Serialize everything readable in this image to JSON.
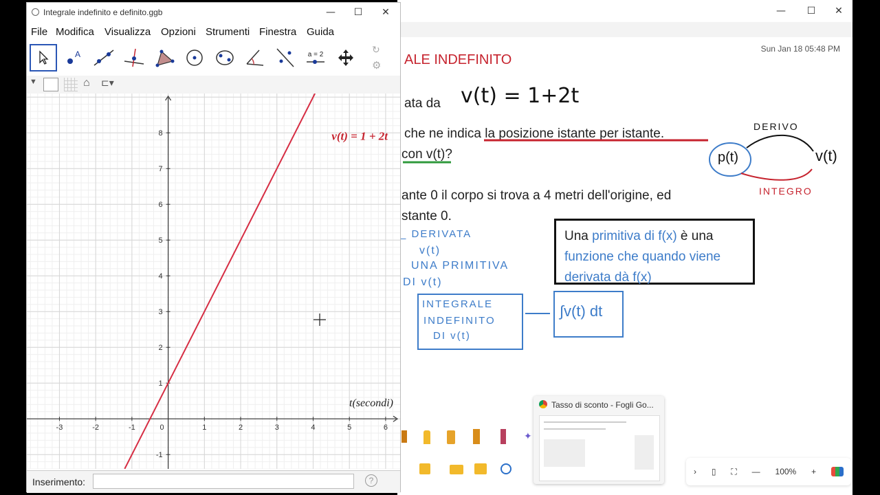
{
  "geogebra": {
    "title": "Integrale indefinito e definito.ggb",
    "menu": [
      "File",
      "Modifica",
      "Visualizza",
      "Opzioni",
      "Strumenti",
      "Finestra",
      "Guida"
    ],
    "tools": [
      {
        "icon": "move-tool-icon"
      },
      {
        "icon": "point-tool-icon"
      },
      {
        "icon": "line-tool-icon"
      },
      {
        "icon": "perpendicular-tool-icon"
      },
      {
        "icon": "polygon-tool-icon"
      },
      {
        "icon": "circle-tool-icon"
      },
      {
        "icon": "conic-tool-icon"
      },
      {
        "icon": "angle-tool-icon"
      },
      {
        "icon": "reflect-tool-icon"
      },
      {
        "icon": "slider-tool-icon",
        "label": "a = 2"
      },
      {
        "icon": "move-graphics-tool-icon"
      }
    ],
    "input_label": "Inserimento:",
    "input_value": "",
    "input_placeholder": ""
  },
  "chart_data": {
    "type": "line",
    "function_label": "v(t) = 1 + 2t",
    "xlabel": "t(secondi)",
    "ylabel": "",
    "xlim": [
      -3.9,
      6.4
    ],
    "ylim": [
      -1.4,
      9.1
    ],
    "x_ticks": [
      -3,
      -2,
      -1,
      0,
      1,
      2,
      3,
      4,
      5,
      6
    ],
    "y_ticks": [
      -1,
      1,
      2,
      3,
      4,
      5,
      6,
      7,
      8
    ],
    "grid": true,
    "series": [
      {
        "x": [
          -1.2,
          4.05
        ],
        "y": [
          -1.4,
          9.1
        ],
        "color": "#d62d43"
      }
    ]
  },
  "whiteboard": {
    "datetime": "Sun Jan 18  05:48 PM",
    "heading": "ALE INDEFINITO",
    "line1": "ata da",
    "formula_hand": "v(t) = 1+2t",
    "line2": "che ne indica la posizione istante per istante.",
    "line3": "con v(t)?",
    "line4": "ante 0 il corpo si trova a 4 metri dell'origine, ed",
    "line5": "stante 0.",
    "hand_deriva": "DERIVO",
    "hand_p": "p(t)",
    "hand_v": "v(t)",
    "hand_integro": "INTEGRO",
    "hand_notes": [
      "_ DERIVATA",
      "v(t)",
      "UNA PRIMITIVA",
      "DI v(t)"
    ],
    "hand_box": [
      "INTEGRALE",
      "INDEFINITO",
      "DI v(t)"
    ],
    "hand_integral": "∫v(t) dt",
    "callout": {
      "text1": "Una ",
      "hl1": "primitiva di f(x)",
      "text2": " è una",
      "hl2": "funzione che quando viene",
      "hl3": "derivata dà f(x)"
    },
    "popup_title": "Tasso di sconto - Fogli Go...",
    "zoom": "100%",
    "colors": {
      "red": "#c6232e",
      "blue": "#3d7cc9",
      "green": "#2f9a3c",
      "callout_blue": "#3d7cc9"
    }
  }
}
